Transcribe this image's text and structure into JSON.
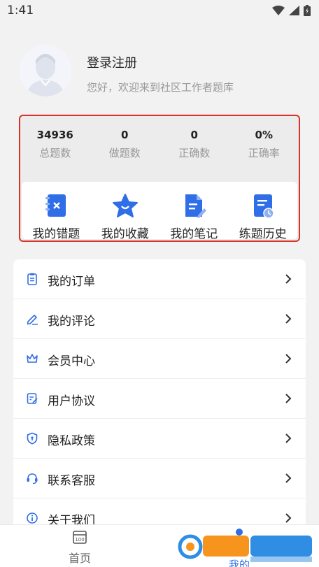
{
  "status_bar": {
    "time": "1:41"
  },
  "profile": {
    "title": "登录注册",
    "subtitle": "您好，欢迎来到社区工作者题库"
  },
  "stats": [
    {
      "value": "34936",
      "label": "总题数"
    },
    {
      "value": "0",
      "label": "做题数"
    },
    {
      "value": "0",
      "label": "正确数"
    },
    {
      "value": "0%",
      "label": "正确率"
    }
  ],
  "shortcuts": [
    {
      "label": "我的错题",
      "icon": "wrong-questions-icon"
    },
    {
      "label": "我的收藏",
      "icon": "favorites-star-icon"
    },
    {
      "label": "我的笔记",
      "icon": "notes-icon"
    },
    {
      "label": "练题历史",
      "icon": "practice-history-icon"
    }
  ],
  "menu": [
    {
      "label": "我的订单",
      "icon": "order-icon"
    },
    {
      "label": "我的评论",
      "icon": "comment-edit-icon"
    },
    {
      "label": "会员中心",
      "icon": "crown-icon"
    },
    {
      "label": "用户协议",
      "icon": "agreement-icon"
    },
    {
      "label": "隐私政策",
      "icon": "shield-icon"
    },
    {
      "label": "联系客服",
      "icon": "headset-icon"
    },
    {
      "label": "关于我们",
      "icon": "info-icon"
    }
  ],
  "bottom_nav": {
    "home_label": "首页",
    "mine_label": "我的"
  },
  "colors": {
    "accent": "#2f6ee6",
    "highlight_border": "#d9342b"
  }
}
